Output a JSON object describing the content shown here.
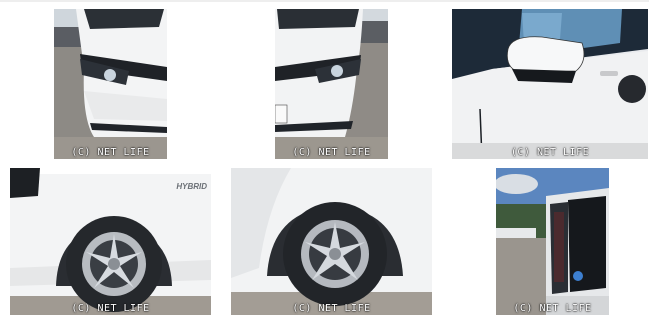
{
  "gallery": {
    "photos": [
      {
        "watermark": "(C) NET LIFE"
      },
      {
        "watermark": "(C) NET LIFE"
      },
      {
        "watermark": "(C) NET LIFE"
      },
      {
        "watermark": "(C) NET LIFE"
      },
      {
        "watermark": "(C) NET LIFE"
      },
      {
        "watermark": "(C) NET LIFE"
      }
    ]
  },
  "badge_text": "HYBRID"
}
